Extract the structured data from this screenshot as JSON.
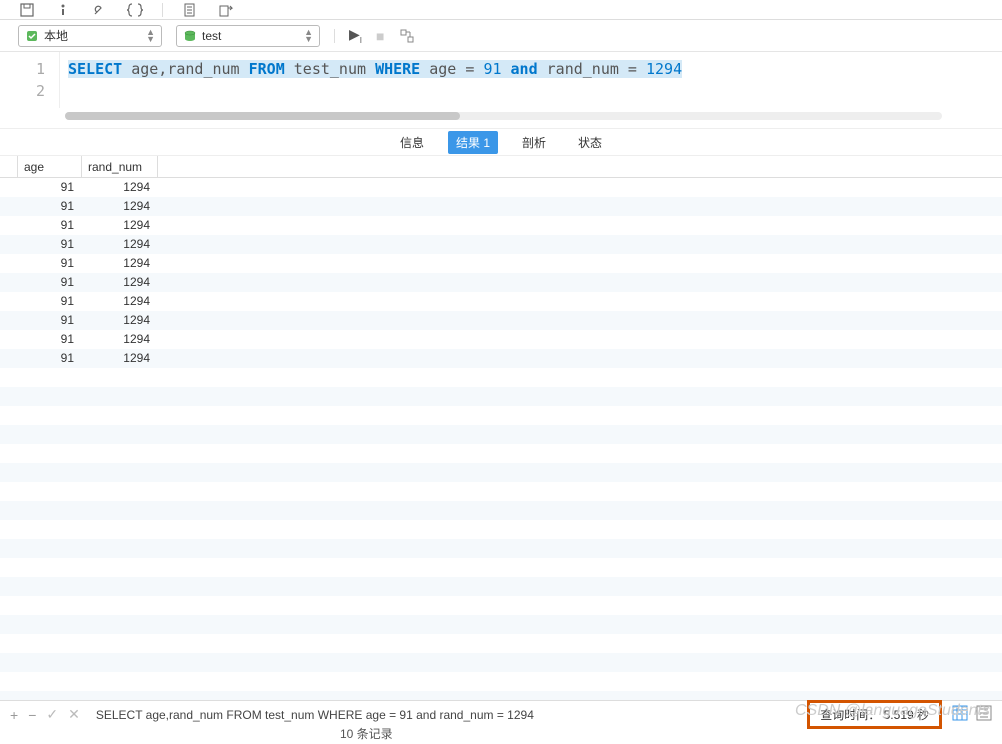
{
  "toolbar": {
    "connection_label": "本地",
    "database_label": "test"
  },
  "editor": {
    "line_numbers": [
      "1",
      "2"
    ],
    "sql_tokens": [
      {
        "t": "SELECT",
        "c": "kw"
      },
      {
        "t": " age,rand_num ",
        "c": "ident"
      },
      {
        "t": "FROM",
        "c": "kw"
      },
      {
        "t": " test_num ",
        "c": "ident"
      },
      {
        "t": "WHERE",
        "c": "kw"
      },
      {
        "t": " age = ",
        "c": "ident"
      },
      {
        "t": "91",
        "c": "num"
      },
      {
        "t": " ",
        "c": "ident"
      },
      {
        "t": "and",
        "c": "kw"
      },
      {
        "t": " rand_num = ",
        "c": "ident"
      },
      {
        "t": "1294",
        "c": "num"
      }
    ]
  },
  "tabs": {
    "info": "信息",
    "result": "结果 1",
    "analyze": "剖析",
    "status": "状态"
  },
  "result": {
    "columns": {
      "age": "age",
      "rand_num": "rand_num"
    },
    "rows": [
      {
        "age": "91",
        "rand_num": "1294"
      },
      {
        "age": "91",
        "rand_num": "1294"
      },
      {
        "age": "91",
        "rand_num": "1294"
      },
      {
        "age": "91",
        "rand_num": "1294"
      },
      {
        "age": "91",
        "rand_num": "1294"
      },
      {
        "age": "91",
        "rand_num": "1294"
      },
      {
        "age": "91",
        "rand_num": "1294"
      },
      {
        "age": "91",
        "rand_num": "1294"
      },
      {
        "age": "91",
        "rand_num": "1294"
      },
      {
        "age": "91",
        "rand_num": "1294"
      }
    ]
  },
  "status": {
    "query_text": "SELECT age,rand_num FROM test_num WHERE age = 91 and rand_num = 1294",
    "query_time": "查询时间： 5.519 秒",
    "record_count": "10 条记录"
  },
  "watermark": "CSDN @languageStudents"
}
